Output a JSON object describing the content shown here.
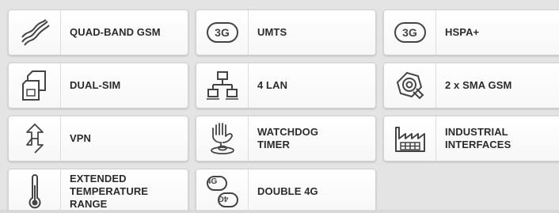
{
  "features": [
    {
      "id": "quad-band-gsm",
      "icon": "waves-icon",
      "label": "QUAD-BAND GSM"
    },
    {
      "id": "umts",
      "icon": "3g-icon",
      "label": "UMTS",
      "badge": "3G"
    },
    {
      "id": "hspa",
      "icon": "3g-icon",
      "label": "HSPA+",
      "badge": "3G"
    },
    {
      "id": "dual-sim",
      "icon": "sim-cards-icon",
      "label": "DUAL-SIM"
    },
    {
      "id": "4-lan",
      "icon": "network-icon",
      "label": "4 LAN"
    },
    {
      "id": "sma-gsm",
      "icon": "antenna-connector-icon",
      "label": "2 x SMA GSM"
    },
    {
      "id": "vpn",
      "icon": "vpn-arrows-icon",
      "label": "VPN"
    },
    {
      "id": "watchdog-timer",
      "icon": "watchdog-hand-icon",
      "label": "WATCHDOG\nTIMER"
    },
    {
      "id": "industrial-interfaces",
      "icon": "factory-icon",
      "label": "INDUSTRIAL\nINTERFACES"
    },
    {
      "id": "extended-temperature-range",
      "icon": "thermometer-icon",
      "label": "EXTENDED\nTEMPERATURE\nRANGE"
    },
    {
      "id": "double-4g",
      "icon": "double-4g-icon",
      "label": "DOUBLE 4G",
      "badge": "4G"
    }
  ]
}
